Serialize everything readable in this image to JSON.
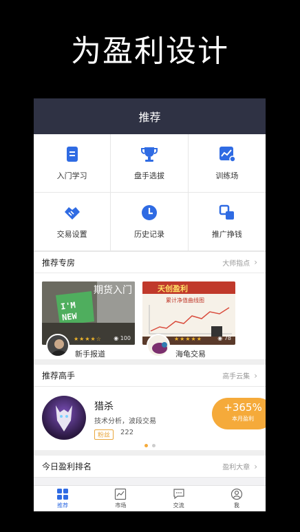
{
  "hero": {
    "title": "为盈利设计"
  },
  "nav": {
    "title": "推荐"
  },
  "grid": [
    {
      "label": "入门学习",
      "icon": "document-icon"
    },
    {
      "label": "盘手选拔",
      "icon": "trophy-icon"
    },
    {
      "label": "训练场",
      "icon": "training-chart-icon"
    },
    {
      "label": "交易设置",
      "icon": "handshake-icon"
    },
    {
      "label": "历史记录",
      "icon": "clock-icon"
    },
    {
      "label": "推广挣钱",
      "icon": "copy-icon"
    }
  ],
  "rooms_section": {
    "title": "推荐专房",
    "more": "大师指点"
  },
  "rooms": [
    {
      "thumb_title": "期货入门",
      "note_text": "I'M NEW",
      "views": "100",
      "name": "新手报道",
      "stars": 4
    },
    {
      "thumb_title": "天创盈利",
      "subtitle": "累计净值曲线图",
      "views": "78",
      "name": "海龟交易",
      "stars": 5
    }
  ],
  "experts_section": {
    "title": "推荐高手",
    "more": "高手云集"
  },
  "expert": {
    "name": "猎杀",
    "desc": "技术分析，波段交易",
    "tag": "粉丝",
    "fans": "222",
    "profit": "+365%",
    "profit_label": "本月盈利"
  },
  "ranking_section": {
    "title": "今日盈利排名",
    "more": "盈利大章"
  },
  "tabs": [
    {
      "label": "推荐",
      "icon": "grid-icon",
      "active": true
    },
    {
      "label": "市场",
      "icon": "trend-icon",
      "active": false
    },
    {
      "label": "交流",
      "icon": "chat-icon",
      "active": false
    },
    {
      "label": "我",
      "icon": "user-icon",
      "active": false
    }
  ],
  "colors": {
    "accent": "#2f6be3",
    "nav_bg": "#2f3244",
    "orange": "#f5aa3a"
  }
}
